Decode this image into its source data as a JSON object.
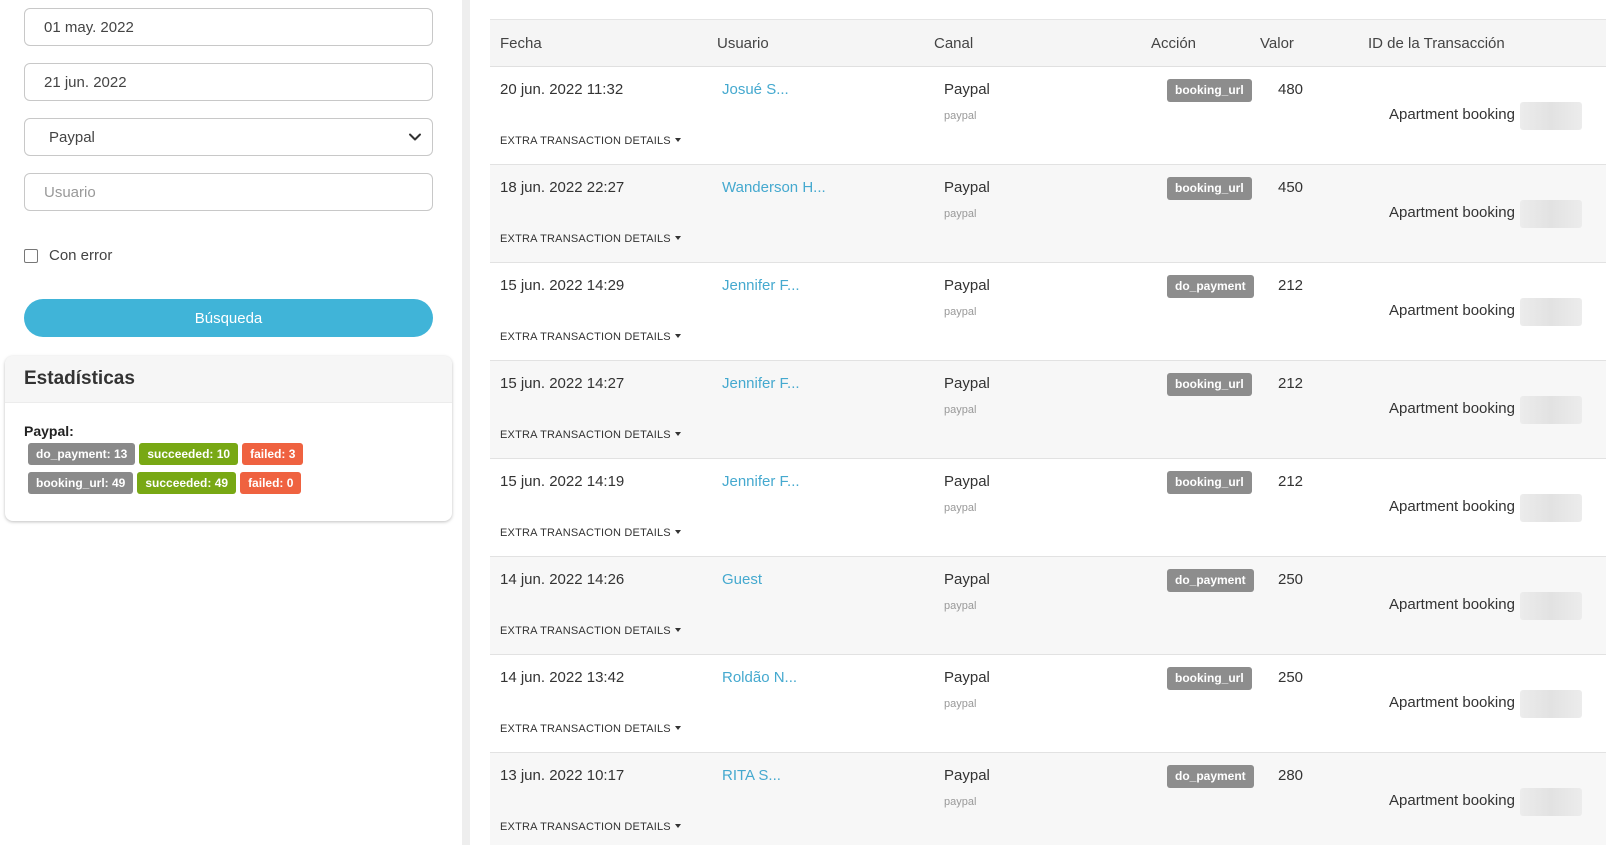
{
  "filters": {
    "date_from": "01 may. 2022",
    "date_to": "21 jun. 2022",
    "channel_selected": "Paypal",
    "user_placeholder": "Usuario",
    "error_checkbox_label": "Con error",
    "search_button": "Búsqueda"
  },
  "stats": {
    "title": "Estadísticas",
    "provider_label": "Paypal:",
    "rows": [
      {
        "action": "do_payment: 13",
        "succeeded": "succeeded: 10",
        "failed": "failed: 3"
      },
      {
        "action": "booking_url: 49",
        "succeeded": "succeeded: 49",
        "failed": "failed: 0"
      }
    ]
  },
  "table": {
    "headers": {
      "date": "Fecha",
      "user": "Usuario",
      "channel": "Canal",
      "action": "Acción",
      "value": "Valor",
      "transaction_id": "ID de la Transacción"
    },
    "extra_label": "EXTRA TRANSACTION DETAILS",
    "rows": [
      {
        "date": "20 jun. 2022 11:32",
        "user": "Josué S...",
        "channel": "Paypal",
        "channel_sub": "paypal",
        "action": "booking_url",
        "value": "480",
        "description": "Apartment booking"
      },
      {
        "date": "18 jun. 2022 22:27",
        "user": "Wanderson H...",
        "channel": "Paypal",
        "channel_sub": "paypal",
        "action": "booking_url",
        "value": "450",
        "description": "Apartment booking"
      },
      {
        "date": "15 jun. 2022 14:29",
        "user": "Jennifer F...",
        "channel": "Paypal",
        "channel_sub": "paypal",
        "action": "do_payment",
        "value": "212",
        "description": "Apartment booking"
      },
      {
        "date": "15 jun. 2022 14:27",
        "user": "Jennifer F...",
        "channel": "Paypal",
        "channel_sub": "paypal",
        "action": "booking_url",
        "value": "212",
        "description": "Apartment booking"
      },
      {
        "date": "15 jun. 2022 14:19",
        "user": "Jennifer F...",
        "channel": "Paypal",
        "channel_sub": "paypal",
        "action": "booking_url",
        "value": "212",
        "description": "Apartment booking"
      },
      {
        "date": "14 jun. 2022 14:26",
        "user": "Guest",
        "channel": "Paypal",
        "channel_sub": "paypal",
        "action": "do_payment",
        "value": "250",
        "description": "Apartment booking"
      },
      {
        "date": "14 jun. 2022 13:42",
        "user": "Roldão N...",
        "channel": "Paypal",
        "channel_sub": "paypal",
        "action": "booking_url",
        "value": "250",
        "description": "Apartment booking"
      },
      {
        "date": "13 jun. 2022 10:17",
        "user": "RITA S...",
        "channel": "Paypal",
        "channel_sub": "paypal",
        "action": "do_payment",
        "value": "280",
        "description": "Apartment booking"
      }
    ]
  },
  "colors": {
    "accent": "#40b4d8",
    "link": "#45a9cf",
    "badge_grey": "#8a8a8a",
    "badge_green": "#78a814",
    "badge_red": "#ef6240"
  },
  "icons": {
    "select_arrow": "chevron-down-icon",
    "extra_toggle": "caret-down-icon"
  }
}
